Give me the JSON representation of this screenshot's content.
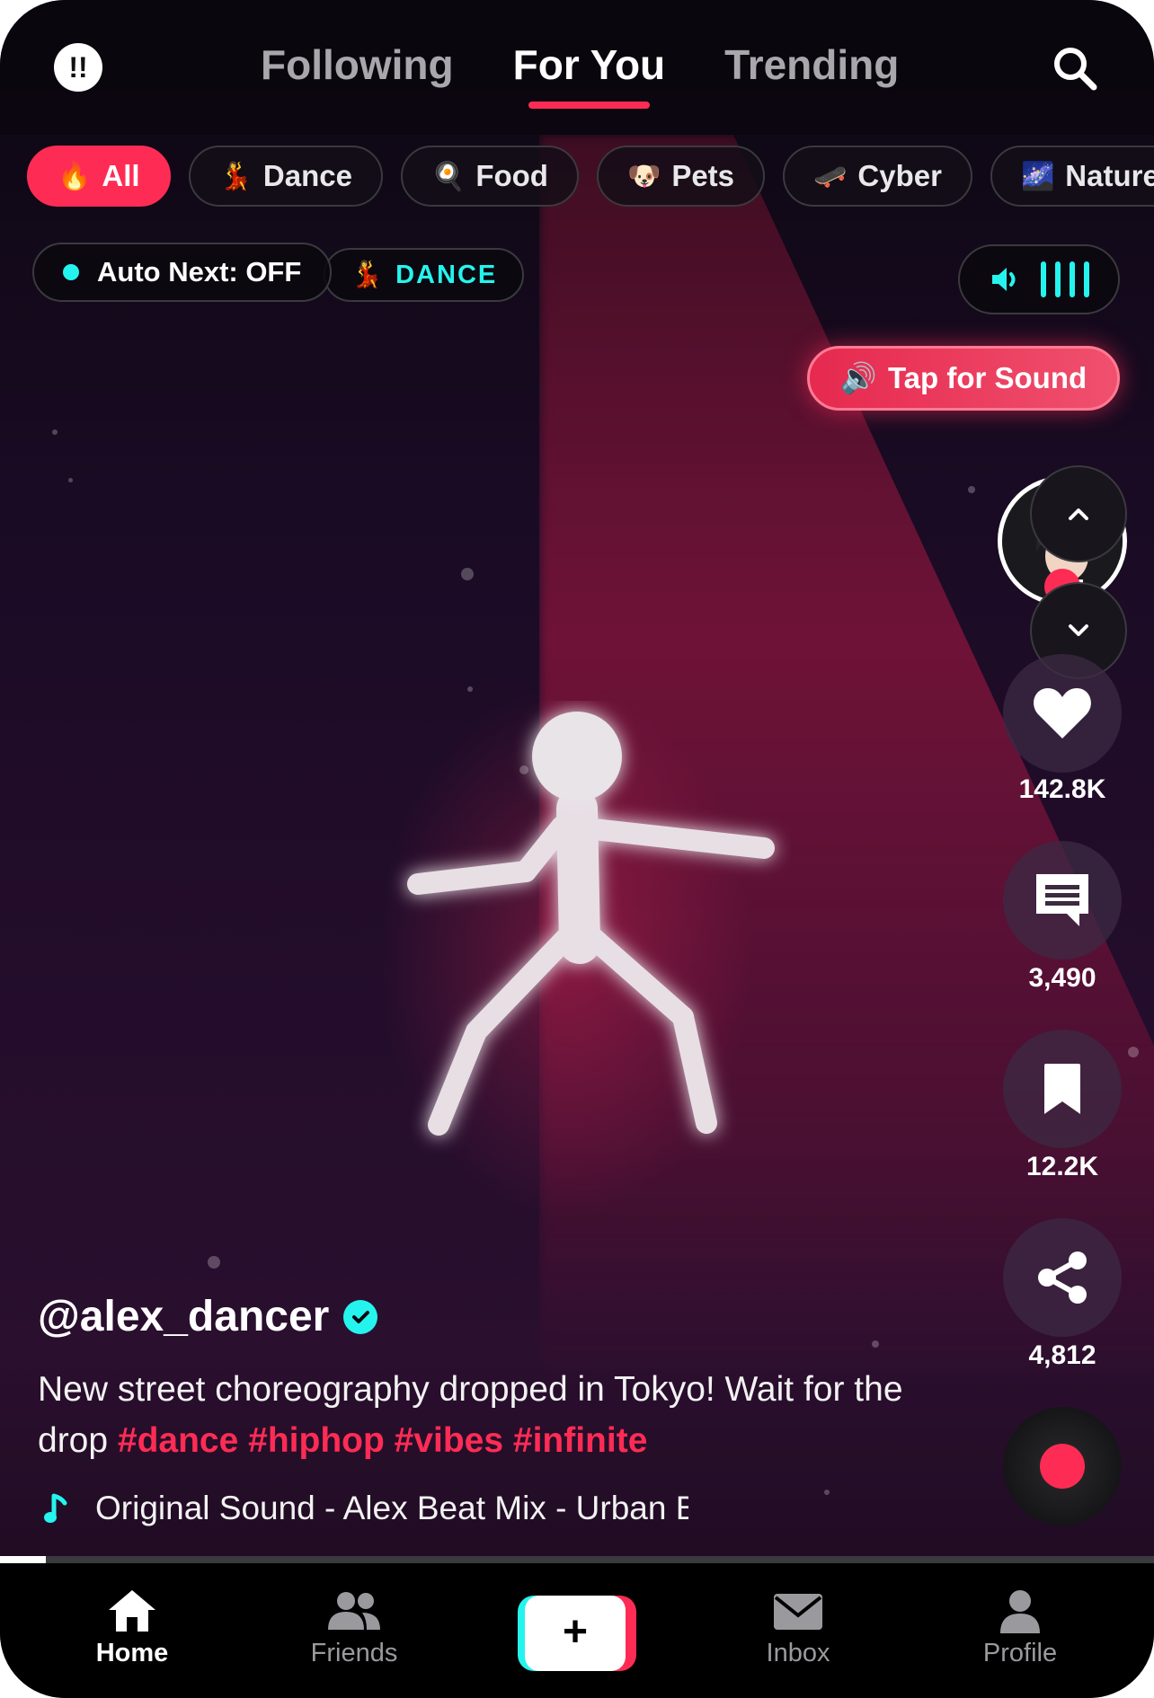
{
  "header": {
    "tabs": [
      {
        "label": "Following",
        "active": false
      },
      {
        "label": "For You",
        "active": true
      },
      {
        "label": "Trending",
        "active": false
      }
    ],
    "logo_glyph": "!!"
  },
  "categories": [
    {
      "icon": "🔥",
      "label": "All",
      "active": true
    },
    {
      "icon": "💃",
      "label": "Dance",
      "active": false
    },
    {
      "icon": "🍳",
      "label": "Food",
      "active": false
    },
    {
      "icon": "🐶",
      "label": "Pets",
      "active": false
    },
    {
      "icon": "🛹",
      "label": "Cyber",
      "active": false
    },
    {
      "icon": "🌌",
      "label": "Nature",
      "active": false
    }
  ],
  "status": {
    "auto_next": "Auto Next: OFF",
    "genre_icon": "💃",
    "genre": "DANCE",
    "tap_for_sound_icon": "🔊",
    "tap_for_sound": "Tap for Sound"
  },
  "actions": {
    "likes": "142.8K",
    "comments": "3,490",
    "bookmarks": "12.2K",
    "shares": "4,812"
  },
  "post": {
    "username": "@alex_dancer",
    "caption": "New street choreography dropped in Tokyo! Wait for the drop ",
    "hashtags": "#dance #hiphop #vibes #infinite",
    "sound": "Original Sound - Alex Beat Mix - Urban Beats"
  },
  "progress": 0.04,
  "bottom_nav": {
    "home": "Home",
    "friends": "Friends",
    "create": "+",
    "inbox": "Inbox",
    "profile": "Profile"
  },
  "colors": {
    "accent": "#fe2c55",
    "cyan": "#25f4ee"
  }
}
